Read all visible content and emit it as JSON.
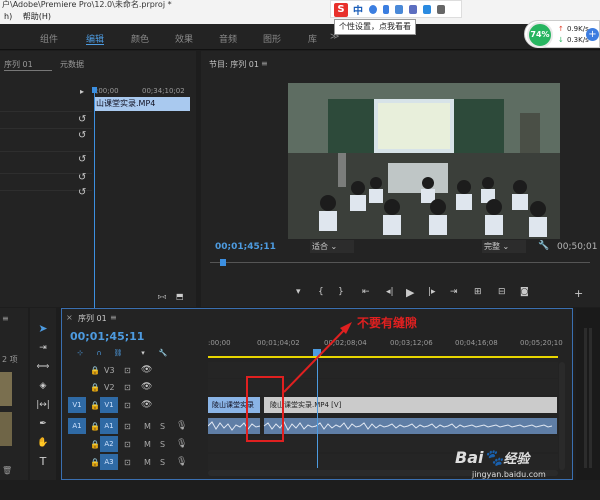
{
  "title_bar": {
    "text": "户\\Adobe\\Premiere Pro\\12.0\\未命名.prproj *"
  },
  "menu": {
    "items": [
      "h)",
      "帮助(H)"
    ]
  },
  "workspaces": {
    "tabs": [
      "组件",
      "编辑",
      "颜色",
      "效果",
      "音频",
      "图形",
      "库"
    ],
    "active": "编辑"
  },
  "ime_bar": {
    "brand": "S",
    "text": "中",
    "tooltip": "个性设置，点我看看"
  },
  "net_widget": {
    "percent": "74%",
    "up": "0.9K/s",
    "down": "0.3K/s"
  },
  "source_panel": {
    "tab_seq": "序列 01",
    "tab_meta": "元数据",
    "time_start": ";00;00",
    "time_end": "00;34;10;02",
    "clip_label": "山课堂实录.MP4"
  },
  "program_panel": {
    "title": "节目: 序列 01",
    "timecode": "00;01;45;11",
    "fit": "适合",
    "quality": "完整",
    "duration": "00;50;01"
  },
  "project_panel": {
    "partial_label": "2 项"
  },
  "timeline": {
    "tab": "序列 01",
    "timecode": "00;01;45;11",
    "ruler": [
      ":00;00",
      "00;01;04;02",
      "00;02;08;04",
      "00;03;12;06",
      "00;04;16;08",
      "00;05;20;10"
    ],
    "video_tracks": [
      "V3",
      "V2",
      "V1"
    ],
    "audio_tracks": [
      "A1",
      "A2",
      "A3"
    ],
    "v1_source": "V1",
    "a1_source": "A1",
    "clip_left": "陵山课堂实录",
    "clip_right": "陵山课堂实录.MP4 [V]",
    "annotation": "不要有缝隙"
  },
  "watermark": {
    "brand": "Bai",
    "brand2": "经验",
    "url": "jingyan.baidu.com"
  }
}
